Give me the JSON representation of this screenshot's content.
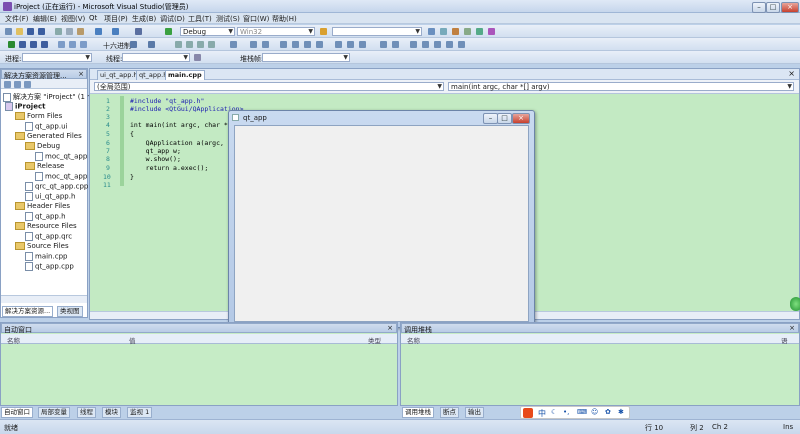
{
  "window": {
    "title": "iProject (正在运行) - Microsoft Visual Studio(管理员)"
  },
  "menu": [
    "文件(F)",
    "编辑(E)",
    "视图(V)",
    "Qt",
    "项目(P)",
    "生成(B)",
    "调试(D)",
    "工具(T)",
    "测试(S)",
    "窗口(W)",
    "帮助(H)"
  ],
  "toolbar": {
    "config": "Debug",
    "platform": "Win32",
    "hex_label": "十六进制",
    "process_label": "进程:",
    "thread_label": "线程:",
    "stack_label": "堆栈帧:"
  },
  "solution": {
    "title": "解决方案资源管理...",
    "items": [
      {
        "label": "解决方案 \"iProject\" (1 个",
        "kind": "solution"
      },
      {
        "label": "iProject",
        "kind": "project"
      },
      {
        "label": "Form Files",
        "kind": "folder"
      },
      {
        "label": "qt_app.ui",
        "kind": "file"
      },
      {
        "label": "Generated Files",
        "kind": "folder"
      },
      {
        "label": "Debug",
        "kind": "folder"
      },
      {
        "label": "moc_qt_app",
        "kind": "file"
      },
      {
        "label": "Release",
        "kind": "folder"
      },
      {
        "label": "moc_qt_app",
        "kind": "file"
      },
      {
        "label": "qrc_qt_app.cpp",
        "kind": "file"
      },
      {
        "label": "ui_qt_app.h",
        "kind": "file"
      },
      {
        "label": "Header Files",
        "kind": "folder"
      },
      {
        "label": "qt_app.h",
        "kind": "file"
      },
      {
        "label": "Resource Files",
        "kind": "folder"
      },
      {
        "label": "qt_app.qrc",
        "kind": "file"
      },
      {
        "label": "Source Files",
        "kind": "folder"
      },
      {
        "label": "main.cpp",
        "kind": "file"
      },
      {
        "label": "qt_app.cpp",
        "kind": "file"
      }
    ],
    "tabs": [
      "解决方案资源...",
      "类视图"
    ]
  },
  "editor": {
    "tabs": [
      "ui_qt_app.h",
      "qt_app.h",
      "main.cpp"
    ],
    "scope": "(全局范围)",
    "function": "main(int argc, char *[] argv)",
    "lines": [
      {
        "n": "1",
        "text": "#include \"qt_app.h\""
      },
      {
        "n": "2",
        "text": "#include <QtGui/QApplication>"
      },
      {
        "n": "3",
        "text": ""
      },
      {
        "n": "4",
        "text": "int main(int argc, char *"
      },
      {
        "n": "5",
        "text": "{"
      },
      {
        "n": "6",
        "text": "    QApplication a(argc,"
      },
      {
        "n": "7",
        "text": "    qt_app w;"
      },
      {
        "n": "8",
        "text": "    w.show();"
      },
      {
        "n": "9",
        "text": "    return a.exec();"
      },
      {
        "n": "10",
        "text": "}"
      },
      {
        "n": "11",
        "text": ""
      }
    ]
  },
  "qtapp": {
    "title": "qt_app"
  },
  "autos": {
    "title": "自动窗口",
    "col_name": "名称",
    "col_value": "值",
    "col_type": "类型"
  },
  "callstack": {
    "title": "调用堆栈",
    "col_name": "名称",
    "col_lang": "语"
  },
  "bottom_tabs_left": [
    "自动窗口",
    "局部变量",
    "线程",
    "模块",
    "监视 1"
  ],
  "bottom_tabs_right": [
    "调用堆栈",
    "断点",
    "输出"
  ],
  "status": {
    "ready": "就绪",
    "line": "行 10",
    "col": "列 2",
    "ch": "Ch 2",
    "ins": "Ins"
  },
  "ime": {
    "lang": "中"
  }
}
